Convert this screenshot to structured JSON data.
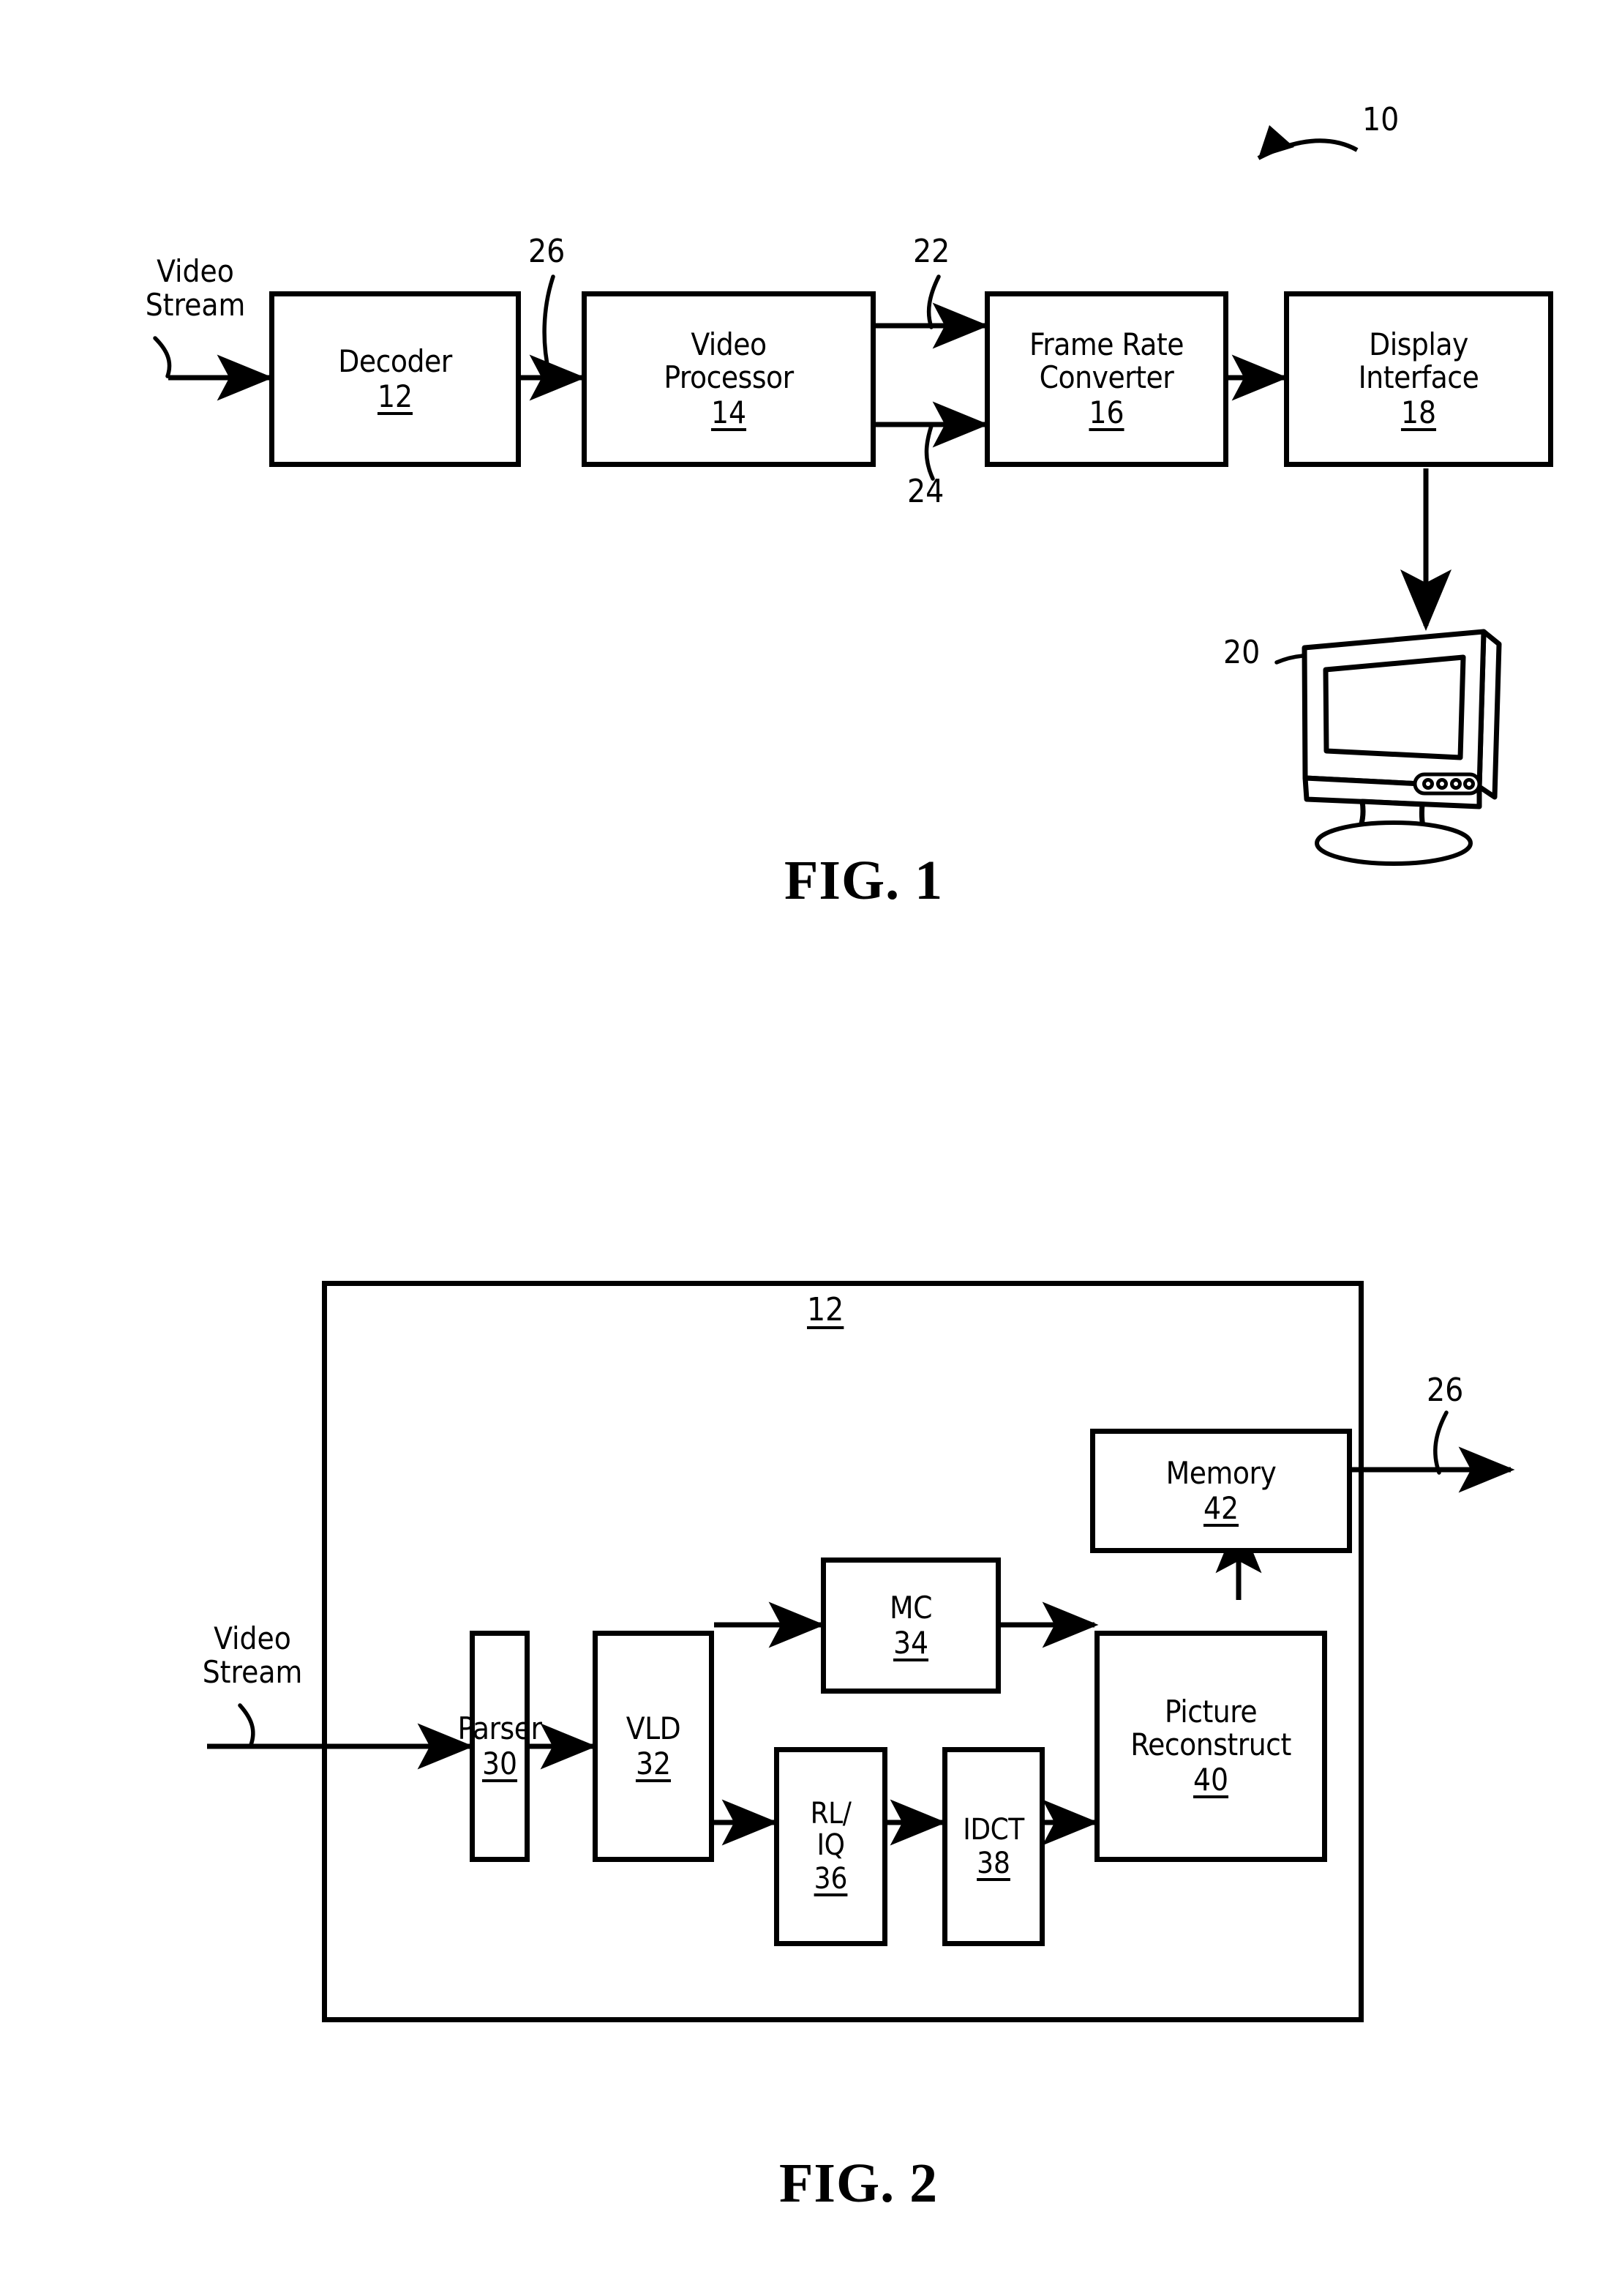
{
  "figures": [
    {
      "id": "fig1",
      "caption": "FIG. 1",
      "system_ref": "10",
      "input_label": "Video\nStream",
      "blocks": [
        {
          "key": "decoder",
          "label": "Decoder",
          "ref": "12"
        },
        {
          "key": "video_processor",
          "label": "Video\nProcessor",
          "ref": "14"
        },
        {
          "key": "frame_rate_conv",
          "label": "Frame Rate\nConverter",
          "ref": "16"
        },
        {
          "key": "display_interface",
          "label": "Display\nInterface",
          "ref": "18"
        }
      ],
      "signal_refs": [
        {
          "key": "sig26",
          "value": "26"
        },
        {
          "key": "sig22",
          "value": "22"
        },
        {
          "key": "sig24",
          "value": "24"
        }
      ],
      "display_device": {
        "key": "monitor",
        "ref": "20",
        "name": "lcd-monitor"
      }
    },
    {
      "id": "fig2",
      "caption": "FIG. 2",
      "container_ref": "12",
      "input_label": "Video\nStream",
      "output_ref": "26",
      "blocks": [
        {
          "key": "parser",
          "label": "Parser",
          "ref": "30"
        },
        {
          "key": "vld",
          "label": "VLD",
          "ref": "32"
        },
        {
          "key": "mc",
          "label": "MC",
          "ref": "34"
        },
        {
          "key": "rliq",
          "label": "RL/\nIQ",
          "ref": "36"
        },
        {
          "key": "idct",
          "label": "IDCT",
          "ref": "38"
        },
        {
          "key": "picture_reconstruct",
          "label": "Picture\nReconstruct",
          "ref": "40"
        },
        {
          "key": "memory",
          "label": "Memory",
          "ref": "42"
        }
      ]
    }
  ],
  "colors": {
    "ink": "#000000",
    "paper": "#ffffff"
  }
}
